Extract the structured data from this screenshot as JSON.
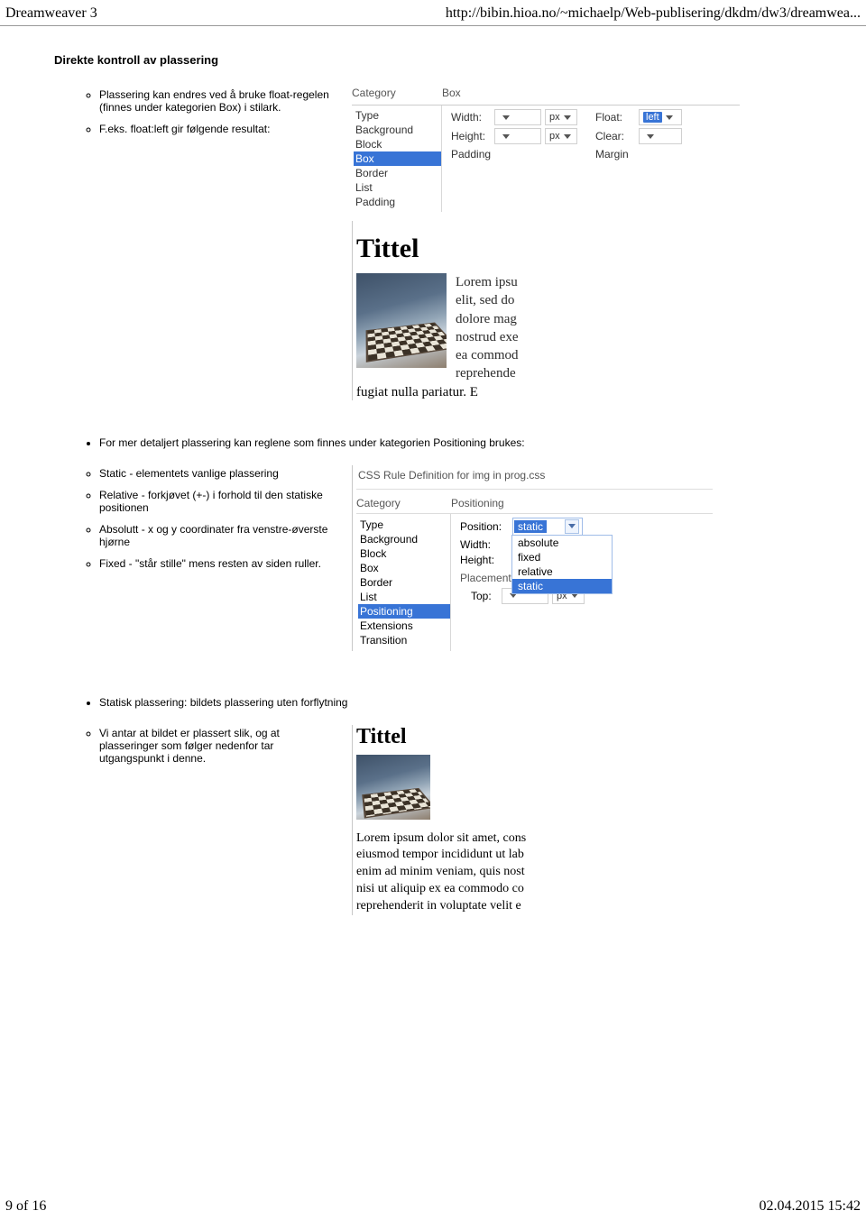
{
  "header": {
    "title": "Dreamweaver 3",
    "url": "http://bibin.hioa.no/~michaelp/Web-publisering/dkdm/dw3/dreamwea..."
  },
  "footer": {
    "pagestr": "9 of 16",
    "datestr": "02.04.2015 15:42"
  },
  "section_title": "Direkte kontroll av plassering",
  "list1": {
    "a": "Plassering kan endres ved å bruke float-regelen (finnes under kategorien Box) i stilark.",
    "b": "F.eks. float:left gir følgende resultat:"
  },
  "panel1": {
    "headers": {
      "a": "Category",
      "b": "Box"
    },
    "categories": [
      "Type",
      "Background",
      "Block",
      "Box",
      "Border",
      "List",
      "Padding"
    ],
    "selected": "Box",
    "row1": {
      "lab1": "Width:",
      "unit": "px",
      "lab2": "Float:",
      "val2": "left"
    },
    "row2": {
      "lab1": "Height:",
      "unit": "px",
      "lab2": "Clear:"
    },
    "row3": {
      "lab1": "Padding",
      "lab2": "Margin"
    }
  },
  "preview1": {
    "title": "Tittel",
    "lines": [
      "Lorem ipsu",
      "elit, sed do",
      "dolore mag",
      "nostrud exe",
      "ea commod",
      "reprehende"
    ],
    "last": "fugiat nulla pariatur. E"
  },
  "bullet2": "For mer detaljert plassering kan reglene som finnes under kategorien Positioning brukes:",
  "list2": {
    "a": "Static - elementets vanlige plassering",
    "b": "Relative - forkjøvet (+-) i forhold til den statiske positionen",
    "c": "Absolutt - x og y coordinater fra venstre-øverste hjørne",
    "d": "Fixed - \"står stille\" mens resten av siden ruller."
  },
  "panel2": {
    "caption": "CSS Rule Definition for img in prog.css",
    "headers": {
      "a": "Category",
      "b": "Positioning"
    },
    "categories": [
      "Type",
      "Background",
      "Block",
      "Box",
      "Border",
      "List",
      "Positioning",
      "Extensions",
      "Transition"
    ],
    "selected": "Positioning",
    "row1": {
      "lab": "Position:",
      "val": "static"
    },
    "dropdown": [
      "absolute",
      "fixed",
      "relative",
      "static"
    ],
    "dropdown_sel": "static",
    "row2": {
      "lab": "Width:"
    },
    "row3": {
      "lab": "Height:"
    },
    "placement": "Placement",
    "row4": {
      "lab": "Top:",
      "unit": "px"
    }
  },
  "bullet3": "Statisk plassering: bildets plassering uten forflytning",
  "list3": {
    "a": "Vi antar at bildet er plassert slik, og at plasseringer som følger nedenfor tar utgangspunkt i denne."
  },
  "preview2": {
    "title": "Tittel",
    "lines": [
      "Lorem ipsum dolor sit amet, cons",
      "eiusmod tempor incididunt ut lab",
      "enim ad minim veniam, quis nost",
      "nisi ut aliquip ex ea commodo co",
      "reprehenderit in voluptate velit e"
    ]
  }
}
